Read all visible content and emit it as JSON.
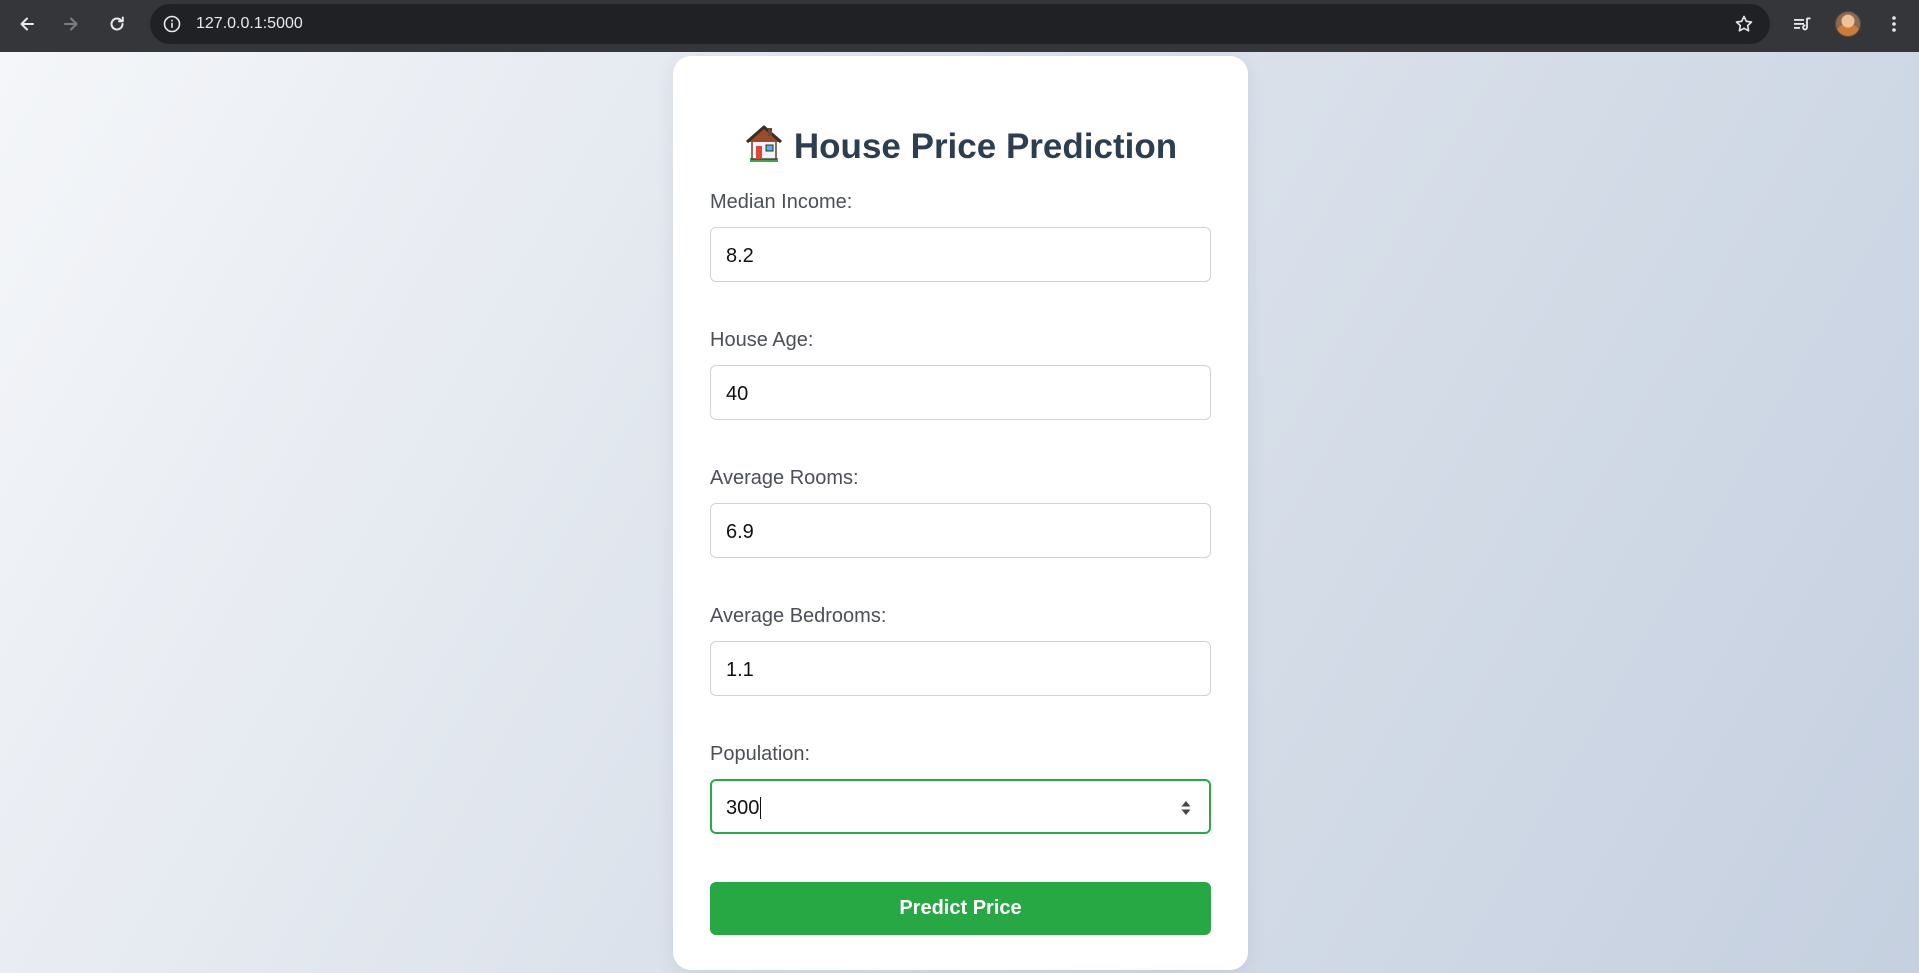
{
  "browser": {
    "url": "127.0.0.1:5000",
    "icons": {
      "back": "arrow-left-icon",
      "forward": "arrow-right-icon",
      "reload": "reload-icon",
      "info": "info-icon",
      "bookmark": "star-icon",
      "media": "media-controls-icon",
      "menu": "kebab-menu-icon"
    }
  },
  "form": {
    "title": "House Price Prediction",
    "title_icon": "house-icon",
    "fields": [
      {
        "label": "Median Income:",
        "value": "8.2"
      },
      {
        "label": "House Age:",
        "value": "40"
      },
      {
        "label": "Average Rooms:",
        "value": "6.9"
      },
      {
        "label": "Average Bedrooms:",
        "value": "1.1"
      },
      {
        "label": "Population:",
        "value": "300",
        "focused": true
      }
    ],
    "submit_label": "Predict Price"
  },
  "colors": {
    "accent": "#28a745",
    "title": "#2c3e50",
    "chrome": "#35363a"
  }
}
